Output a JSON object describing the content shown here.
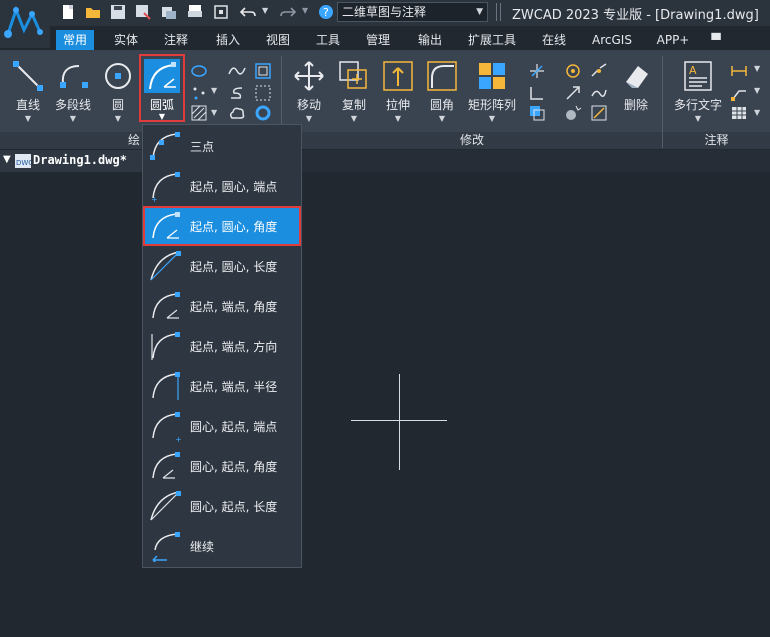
{
  "title_bar": {
    "workspace": "二维草图与注释",
    "title": "ZWCAD 2023 专业版 - [Drawing1.dwg]",
    "quick_access_icons": [
      "new-icon",
      "open-icon",
      "save-icon",
      "save-as-icon",
      "print-icon",
      "plot-icon",
      "zoom-icon",
      "undo-icon",
      "redo-icon",
      "help-icon"
    ]
  },
  "ribbon": {
    "tabs": [
      "常用",
      "实体",
      "注释",
      "插入",
      "视图",
      "工具",
      "管理",
      "输出",
      "扩展工具",
      "在线",
      "ArcGIS",
      "APP+"
    ],
    "active_tab": "常用",
    "draw_buttons": [
      "直线",
      "多段线",
      "圆",
      "圆弧"
    ],
    "modify_buttons": [
      "移动",
      "复制",
      "拉伸",
      "圆角",
      "矩形阵列",
      "删除"
    ],
    "annotate_buttons": [
      "多行文字"
    ],
    "panels": [
      "绘",
      "修改",
      "注释"
    ]
  },
  "document": {
    "tab": "Drawing1.dwg*"
  },
  "arc_menu": {
    "items": [
      "三点",
      "起点, 圆心, 端点",
      "起点, 圆心, 角度",
      "起点, 圆心, 长度",
      "起点, 端点, 角度",
      "起点, 端点, 方向",
      "起点, 端点, 半径",
      "圆心, 起点, 端点",
      "圆心, 起点, 角度",
      "圆心, 起点, 长度",
      "继续"
    ],
    "selected": "起点, 圆心, 角度"
  },
  "colors": {
    "accent": "#1b8ee0",
    "highlight_border": "#e03c3c",
    "canvas": "#212830",
    "ribbon": "#3a4350"
  }
}
